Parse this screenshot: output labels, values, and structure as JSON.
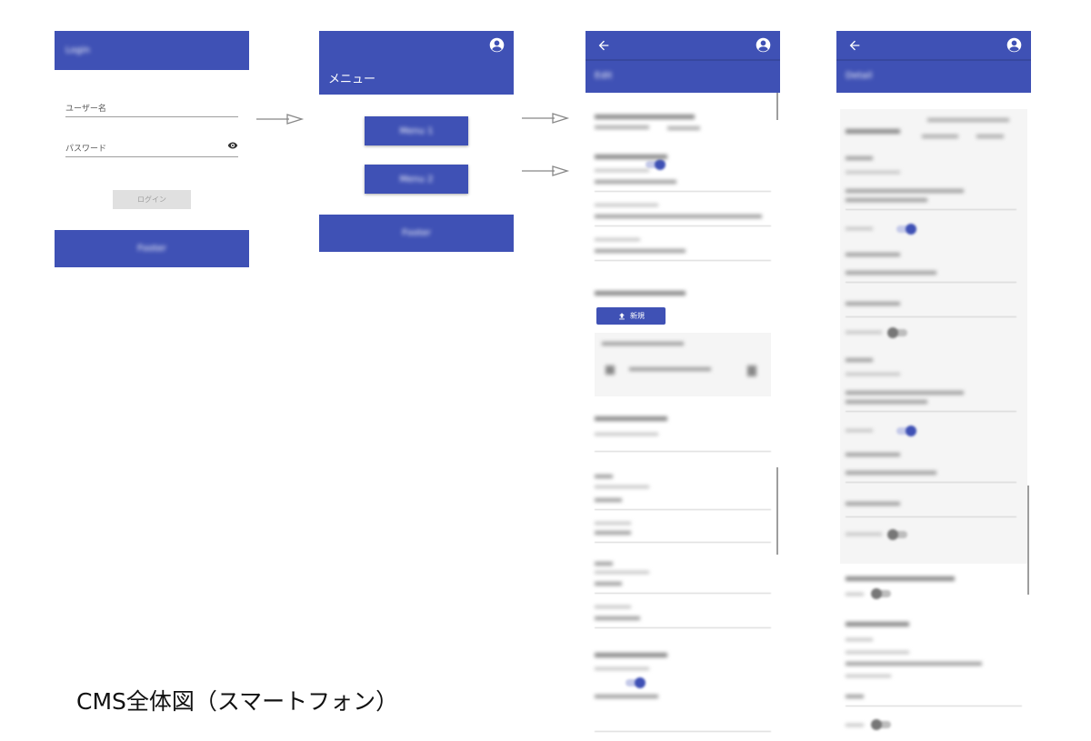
{
  "caption": "CMS全体図（スマートフォン）",
  "colors": {
    "primary": "#3f51b5",
    "disabled_button": "#e0e0e0",
    "text": "#333333"
  },
  "login": {
    "app_title": "Login",
    "username_placeholder": "ユーザー名",
    "password_placeholder": "パスワード",
    "password_icon": "eye-icon",
    "login_button": "ログイン",
    "footer_text": "Footer"
  },
  "menu": {
    "title": "メニュー",
    "account_icon": "account-circle-icon",
    "buttons": [
      "Menu 1",
      "Menu 2"
    ],
    "footer_text": "Footer"
  },
  "edit": {
    "back_icon": "arrow-back-icon",
    "account_icon": "account-circle-icon",
    "subtitle": "Edit",
    "upload_label": "新規",
    "upload_icon": "upload-icon"
  },
  "detail": {
    "back_icon": "arrow-back-icon",
    "account_icon": "account-circle-icon",
    "subtitle": "Detail"
  }
}
